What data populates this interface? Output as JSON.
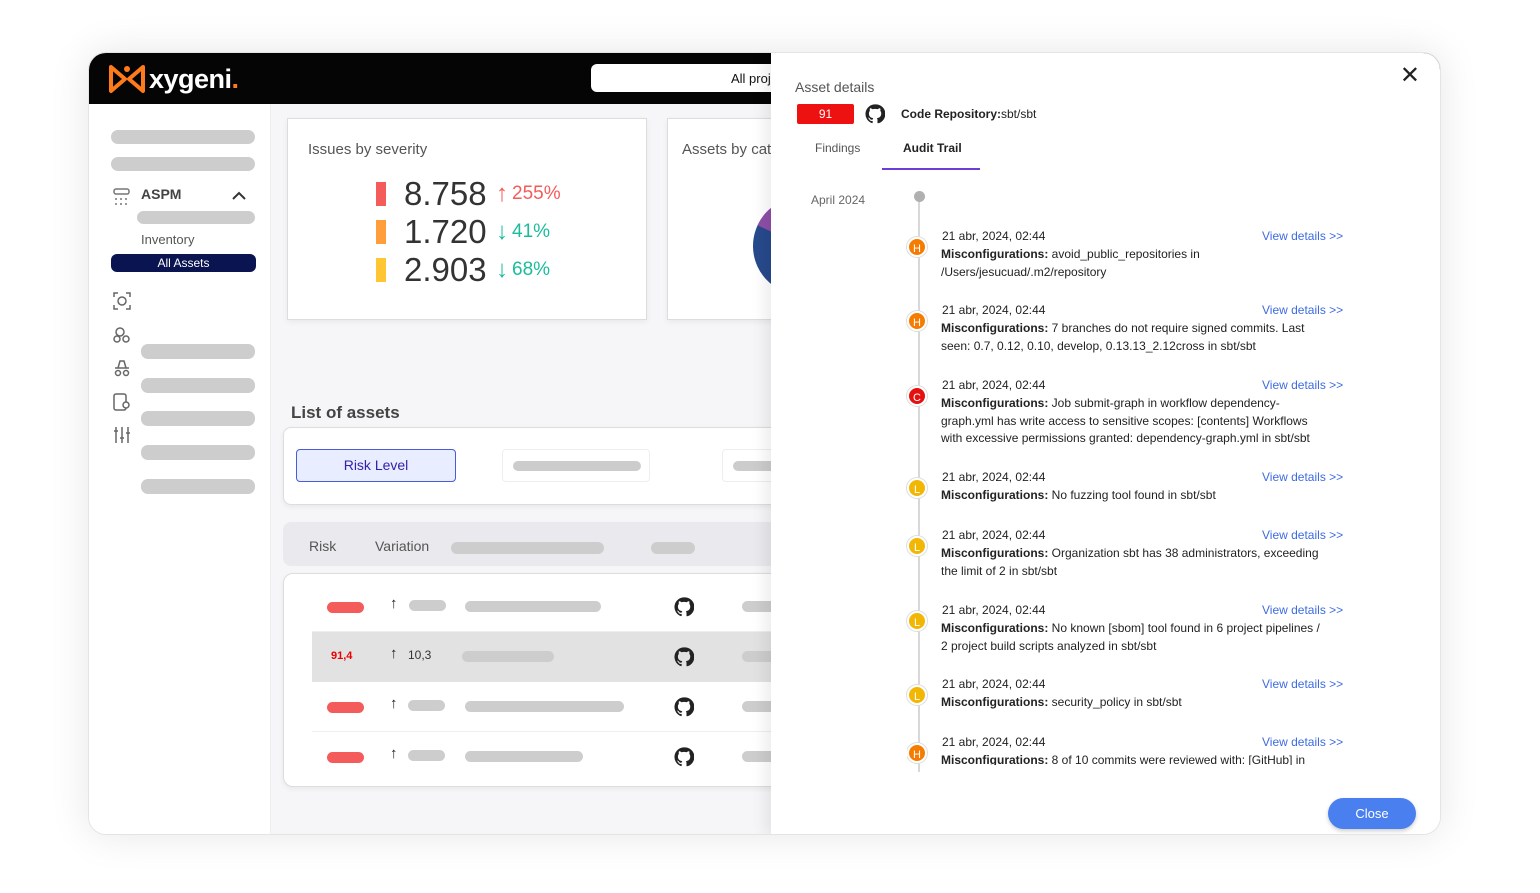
{
  "app": {
    "brand": "xygeni",
    "brand_dot": ".",
    "project_selector": "All proj"
  },
  "sidebar": {
    "aspm_label": "ASPM",
    "inventory_label": "Inventory",
    "all_assets_label": "All Assets"
  },
  "dashboard": {
    "issues_title": "Issues by severity",
    "assets_title": "Assets by cat",
    "severity_rows": [
      {
        "value": "8.758",
        "direction": "up",
        "pct": "255%",
        "color": "#f45b5b",
        "pct_color": "#f45b5b"
      },
      {
        "value": "1.720",
        "direction": "down",
        "pct": "41%",
        "color": "#ff9e3a",
        "pct_color": "#1abc9c"
      },
      {
        "value": "2.903",
        "direction": "down",
        "pct": "68%",
        "color": "#ffc533",
        "pct_color": "#1abc9c"
      }
    ],
    "list_title": "List of assets",
    "risk_level_btn": "Risk Level",
    "table_headers": {
      "risk": "Risk",
      "variation": "Variation"
    },
    "selected_row": {
      "risk": "91,4",
      "variation": "10,3"
    }
  },
  "panel": {
    "title": "Asset details",
    "score": "91",
    "repo_label": "Code Repository:",
    "repo_value": "sbt/sbt",
    "tabs": {
      "findings": "Findings",
      "audit_trail": "Audit Trail"
    },
    "month": "April 2024",
    "view_details": "View details >>",
    "events": [
      {
        "sev": "H",
        "color": "#f57c00",
        "date": "21 abr, 2024, 02:44",
        "kind": "Misconfigurations:",
        "text": " avoid_public_repositories in /Users/jesucuad/.m2/repository"
      },
      {
        "sev": "H",
        "color": "#f57c00",
        "date": "21 abr, 2024, 02:44",
        "kind": "Misconfigurations:",
        "text": " 7 branches do not require signed commits. Last seen: 0.7, 0.12, 0.10, develop, 0.13.13_2.12cross in sbt/sbt"
      },
      {
        "sev": "C",
        "color": "#e51010",
        "date": "21 abr, 2024, 02:44",
        "kind": "Misconfigurations:",
        "text": " Job submit-graph in workflow dependency-graph.yml has write access to sensitive scopes: [contents] Workflows with excessive permissions granted: dependency-graph.yml in sbt/sbt"
      },
      {
        "sev": "L",
        "color": "#f2b705",
        "date": "21 abr, 2024, 02:44",
        "kind": "Misconfigurations:",
        "text": " No fuzzing tool found in sbt/sbt"
      },
      {
        "sev": "L",
        "color": "#f2b705",
        "date": "21 abr, 2024, 02:44",
        "kind": "Misconfigurations:",
        "text": " Organization sbt has 38 administrators, exceeding the limit of 2 in sbt/sbt"
      },
      {
        "sev": "L",
        "color": "#f2b705",
        "date": "21 abr, 2024, 02:44",
        "kind": "Misconfigurations:",
        "text": " No known [sbom] tool found in 6 project pipelines / 2 project build scripts analyzed in sbt/sbt"
      },
      {
        "sev": "L",
        "color": "#f2b705",
        "date": "21 abr, 2024, 02:44",
        "kind": "Misconfigurations:",
        "text": " security_policy in sbt/sbt"
      },
      {
        "sev": "H",
        "color": "#f57c00",
        "date": "21 abr, 2024, 02:44",
        "kind": "Misconfigurations:",
        "text": " 8 of 10 commits were reviewed with: [GitHub] in"
      }
    ],
    "close_btn": "Close"
  }
}
